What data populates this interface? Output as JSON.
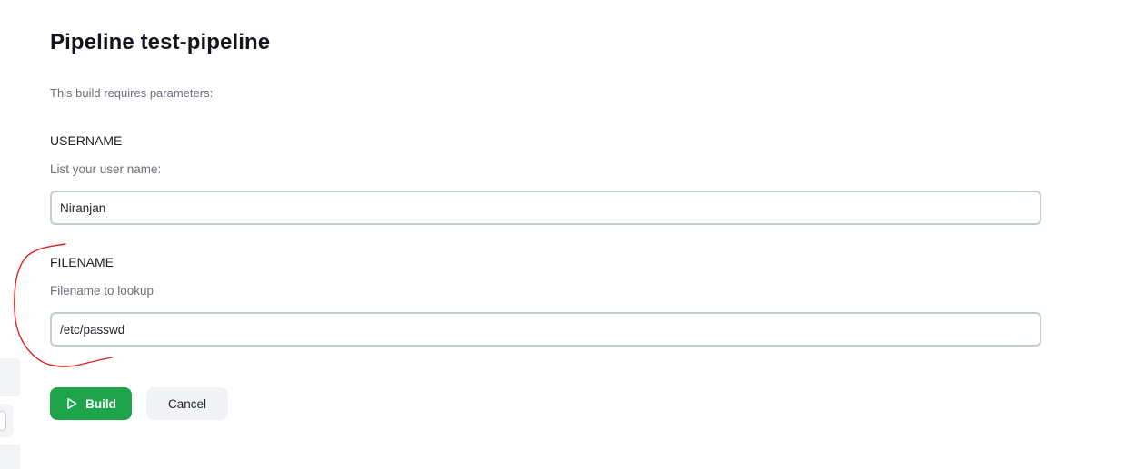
{
  "page": {
    "title": "Pipeline test-pipeline",
    "intro": "This build requires parameters:"
  },
  "parameters": [
    {
      "name": "USERNAME",
      "description": "List your user name:",
      "value": "Niranjan"
    },
    {
      "name": "FILENAME",
      "description": "Filename to lookup",
      "value": "/etc/passwd"
    }
  ],
  "actions": {
    "build_label": "Build",
    "cancel_label": "Cancel"
  },
  "colors": {
    "build_button": "#1ea54c",
    "cancel_button": "#f2f3f6",
    "annotation_stroke": "#e02020",
    "input_border": "#c3ccd3"
  },
  "icons": {
    "build": "play-icon"
  }
}
